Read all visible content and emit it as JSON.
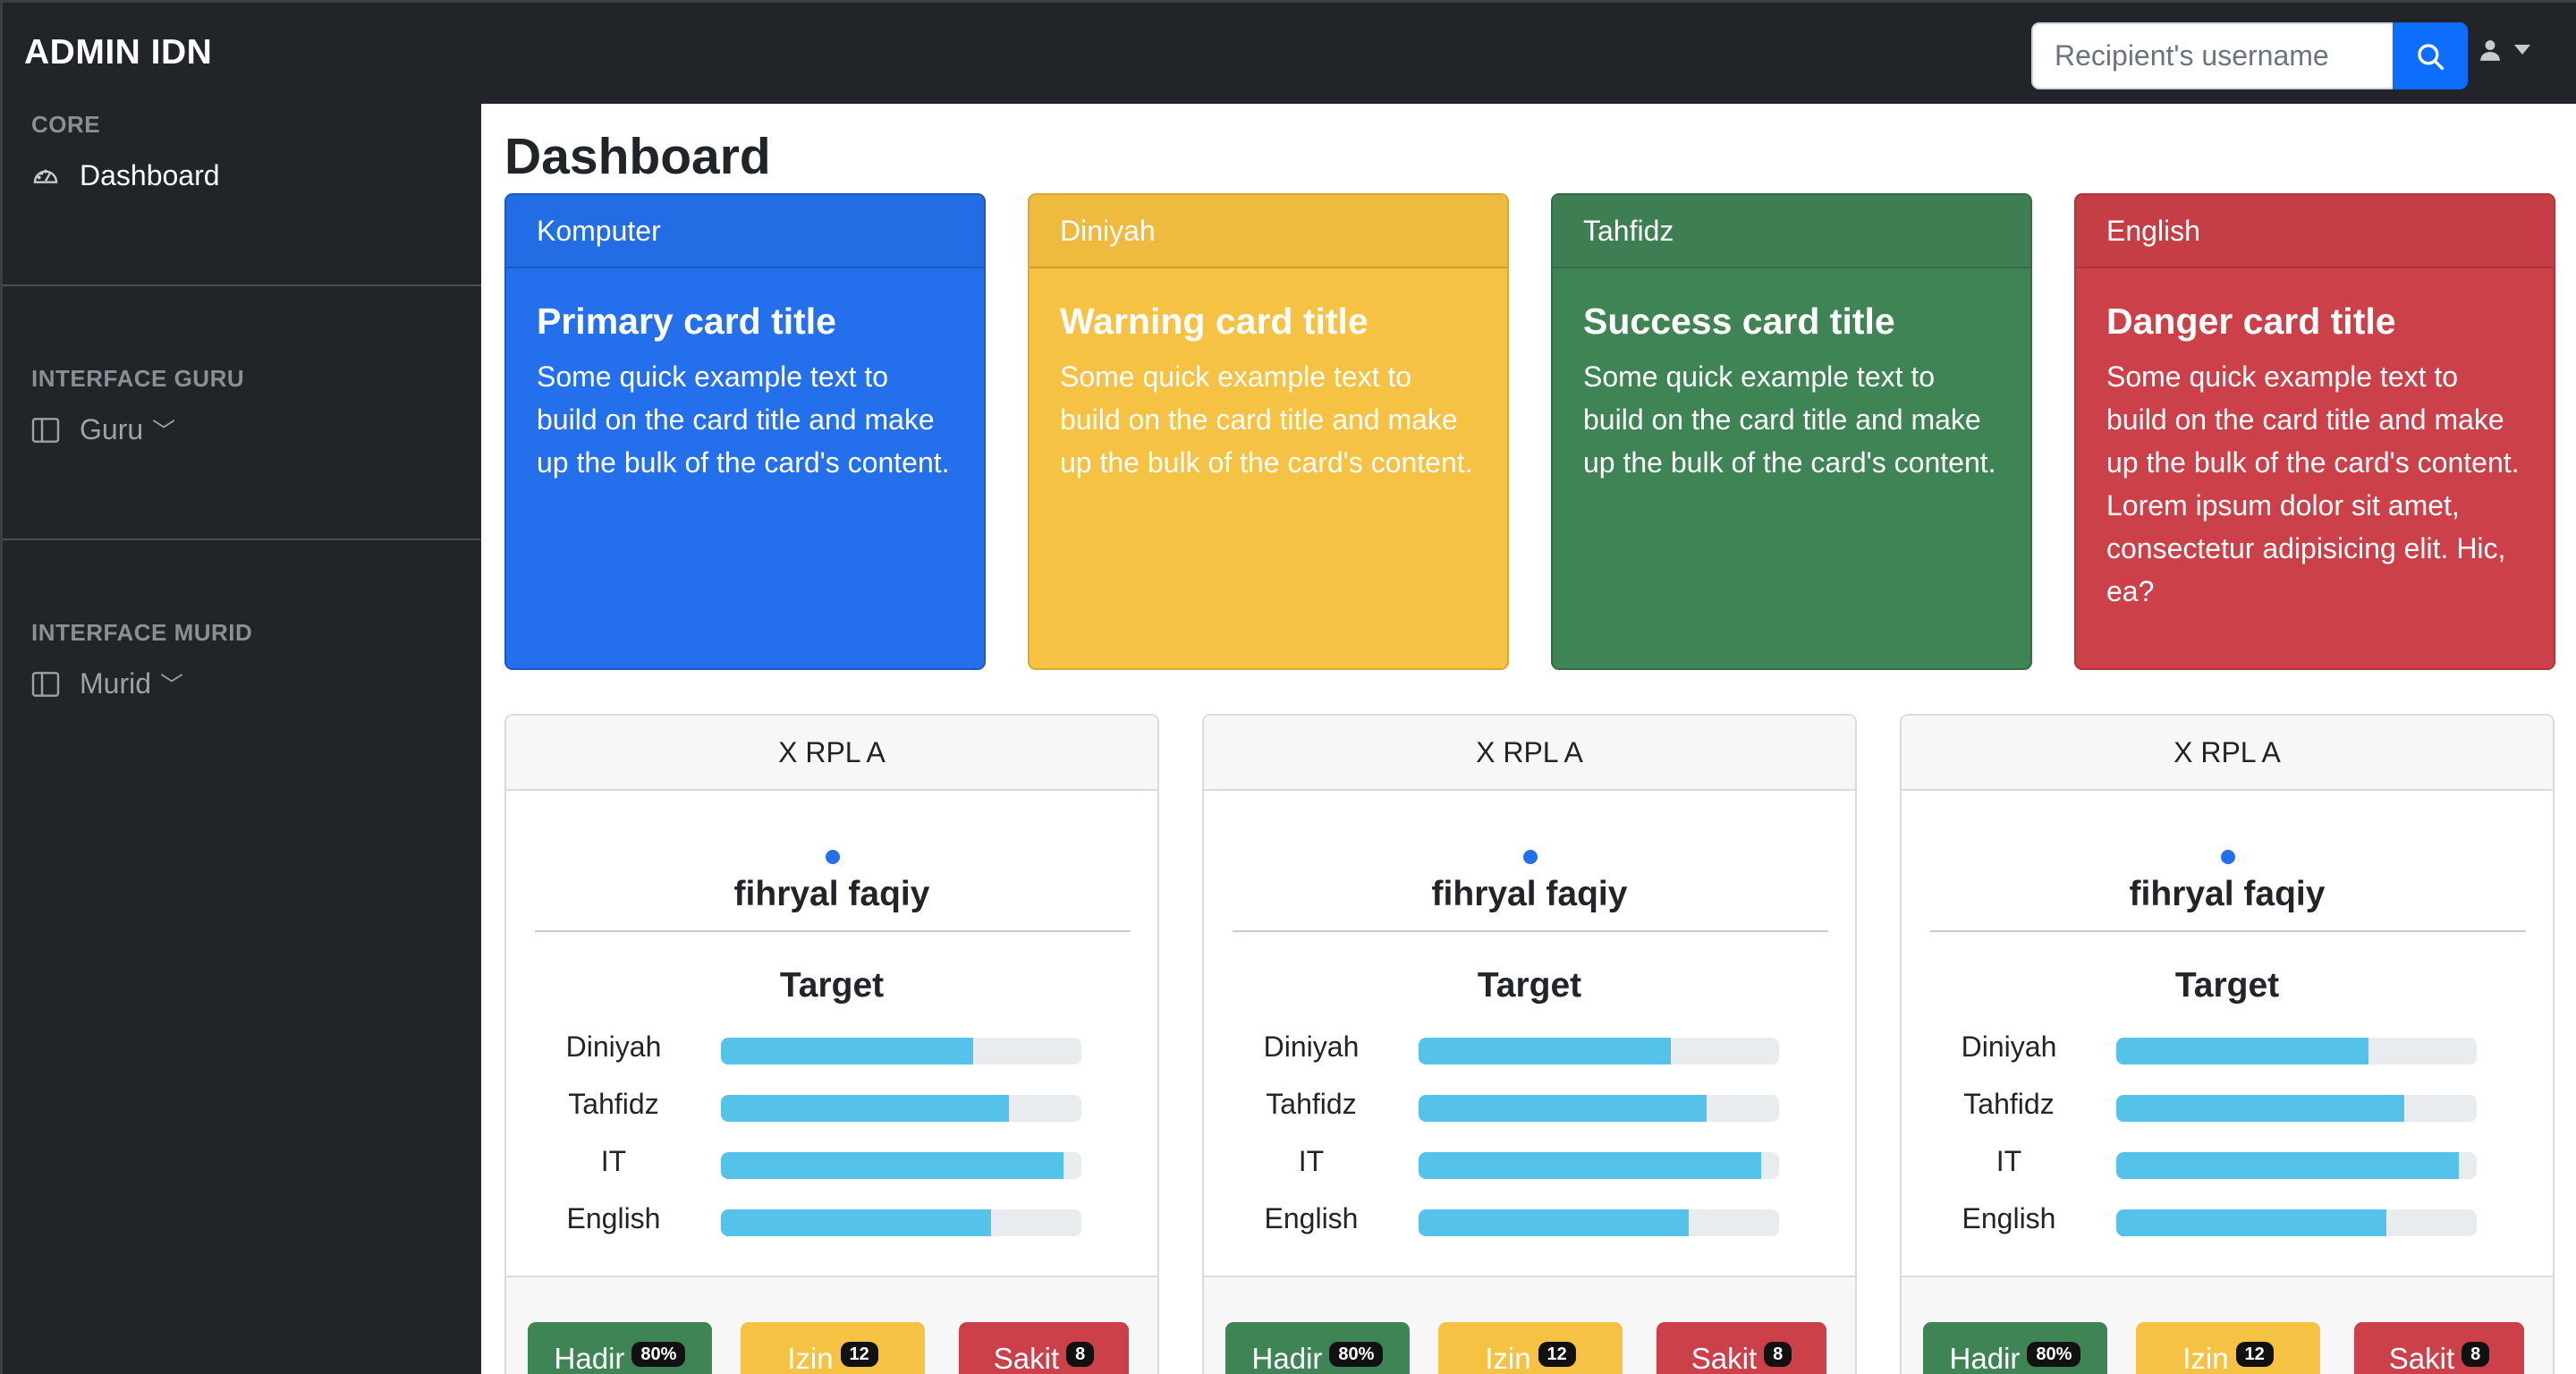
{
  "app": {
    "brand": "ADMIN IDN",
    "search": {
      "placeholder": "Recipient's username",
      "value": ""
    },
    "icons": {
      "search": "search-icon",
      "user": "user-icon",
      "caret": "caret-down-icon"
    }
  },
  "sidebar": {
    "sections": [
      {
        "heading": "CORE",
        "item": {
          "label": "Dashboard",
          "icon": "speedometer-icon",
          "chevron": ""
        }
      },
      {
        "heading": "INTERFACE GURU",
        "item": {
          "label": "Guru",
          "icon": "columns-icon",
          "chevron": "﹀"
        }
      },
      {
        "heading": "INTERFACE MURID",
        "item": {
          "label": "Murid",
          "icon": "columns-icon",
          "chevron": "﹀"
        }
      }
    ]
  },
  "main": {
    "title": "Dashboard",
    "cards": [
      {
        "header": "Komputer",
        "title": "Primary card title",
        "text": "Some quick example text to build on the card title and make up the bulk of the card's content.",
        "color": "#2470ec"
      },
      {
        "header": "Diniyah",
        "title": "Warning card title",
        "text": "Some quick example text to build on the card title and make up the bulk of the card's content.",
        "color": "#f6c244"
      },
      {
        "header": "Tahfidz",
        "title": "Success card title",
        "text": "Some quick example text to build on the card title and make up the bulk of the card's content.",
        "color": "#3f8455"
      },
      {
        "header": "English",
        "title": "Danger card title",
        "text": "Some quick example text to build on the card title and make up the bulk of the card's content. Lorem ipsum dolor sit amet, consectetur adipisicing elit. Hic, ea?",
        "color": "#cc4149"
      }
    ],
    "students": [
      {
        "class": "X RPL A",
        "name": "fihryal faqiy",
        "target_label": "Target",
        "progress": [
          {
            "label": "Diniyah",
            "value": 70
          },
          {
            "label": "Tahfidz",
            "value": 80
          },
          {
            "label": "IT",
            "value": 95
          },
          {
            "label": "English",
            "value": 75
          }
        ],
        "stats": [
          {
            "label": "Hadir",
            "badge": "80%"
          },
          {
            "label": "Izin",
            "badge": "12"
          },
          {
            "label": "Sakit",
            "badge": "8"
          }
        ]
      },
      {
        "class": "X RPL A",
        "name": "fihryal faqiy",
        "target_label": "Target",
        "progress": [
          {
            "label": "Diniyah",
            "value": 70
          },
          {
            "label": "Tahfidz",
            "value": 80
          },
          {
            "label": "IT",
            "value": 95
          },
          {
            "label": "English",
            "value": 75
          }
        ],
        "stats": [
          {
            "label": "Hadir",
            "badge": "80%"
          },
          {
            "label": "Izin",
            "badge": "12"
          },
          {
            "label": "Sakit",
            "badge": "8"
          }
        ]
      },
      {
        "class": "X RPL A",
        "name": "fihryal faqiy",
        "target_label": "Target",
        "progress": [
          {
            "label": "Diniyah",
            "value": 70
          },
          {
            "label": "Tahfidz",
            "value": 80
          },
          {
            "label": "IT",
            "value": 95
          },
          {
            "label": "English",
            "value": 75
          }
        ],
        "stats": [
          {
            "label": "Hadir",
            "badge": "80%"
          },
          {
            "label": "Izin",
            "badge": "12"
          },
          {
            "label": "Sakit",
            "badge": "8"
          }
        ]
      }
    ]
  }
}
